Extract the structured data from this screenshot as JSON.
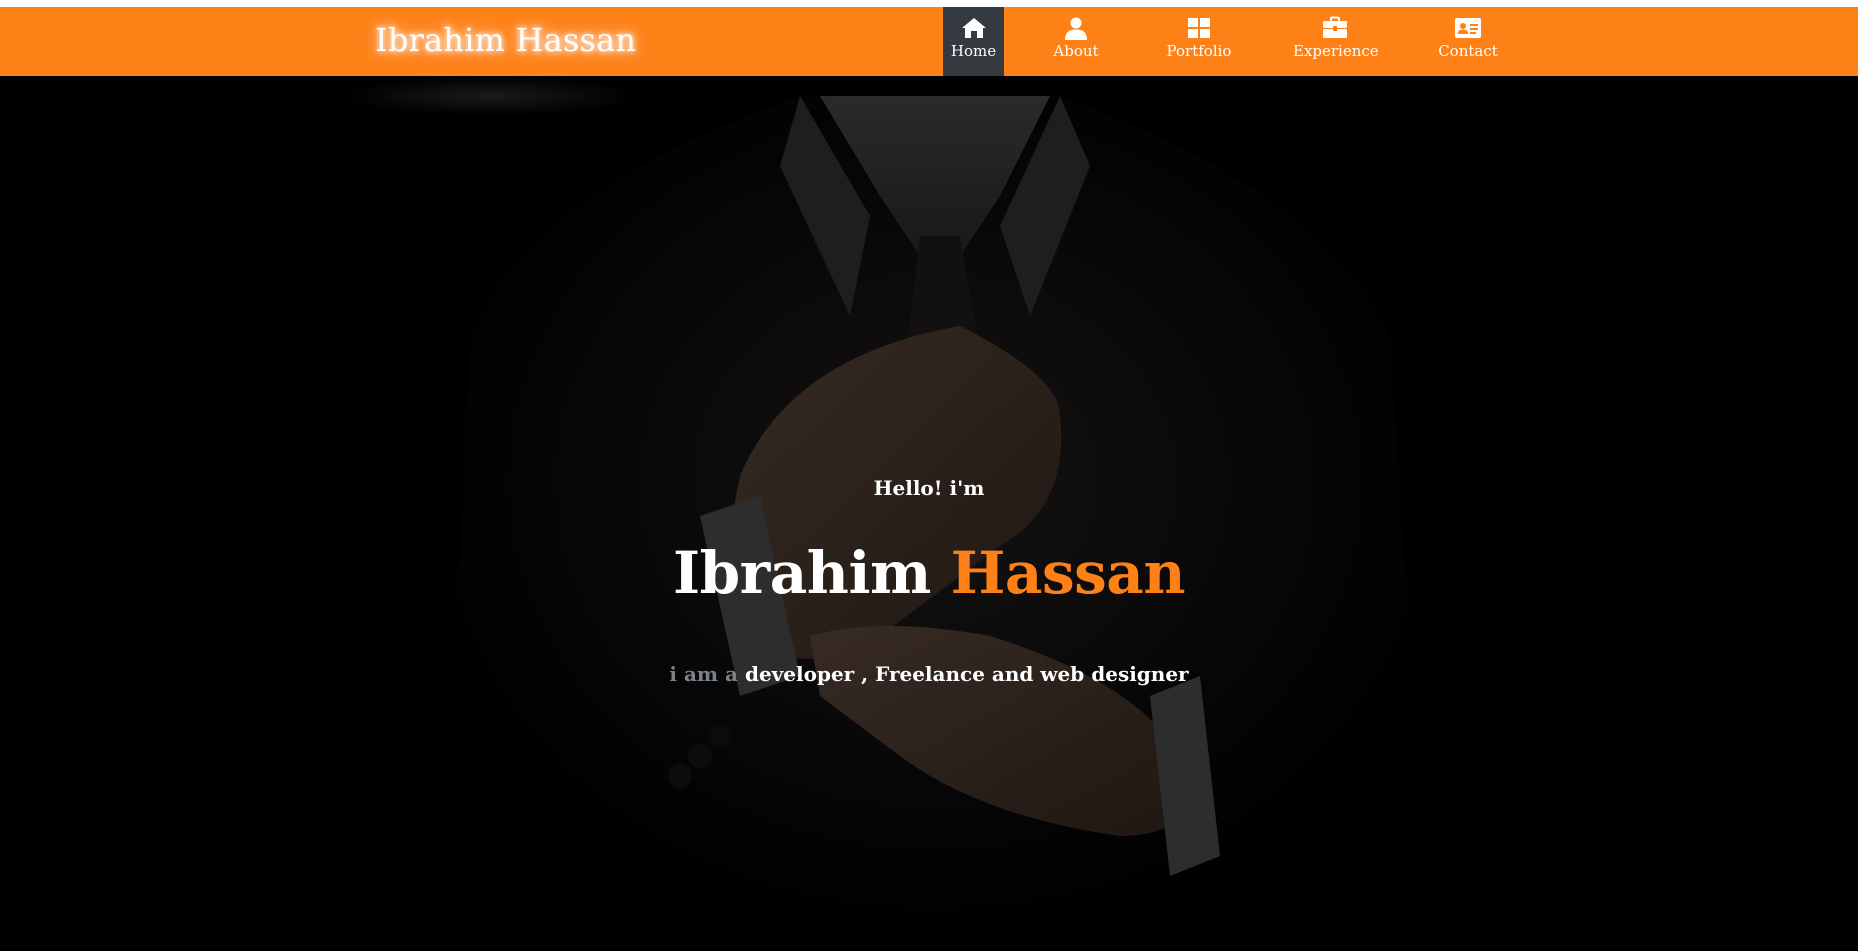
{
  "header": {
    "brand": "Ibrahim Hassan"
  },
  "nav": {
    "items": [
      {
        "label": "Home",
        "icon": "home-icon",
        "active": true
      },
      {
        "label": "About",
        "icon": "user-icon",
        "active": false
      },
      {
        "label": "Portfolio",
        "icon": "grid-icon",
        "active": false
      },
      {
        "label": "Experience",
        "icon": "briefcase-icon",
        "active": false
      },
      {
        "label": "Contact",
        "icon": "contact-card-icon",
        "active": false
      }
    ]
  },
  "hero": {
    "greeting": "Hello! i'm",
    "first_name": "Ibrahim",
    "last_name": "Hassan",
    "tagline_prefix": "i am a",
    "tagline_rest": "developer , Freelance and web designer"
  },
  "colors": {
    "accent": "#fe8118",
    "nav_active": "#343a40",
    "muted_text": "#7c828a",
    "text": "#ffffff"
  }
}
